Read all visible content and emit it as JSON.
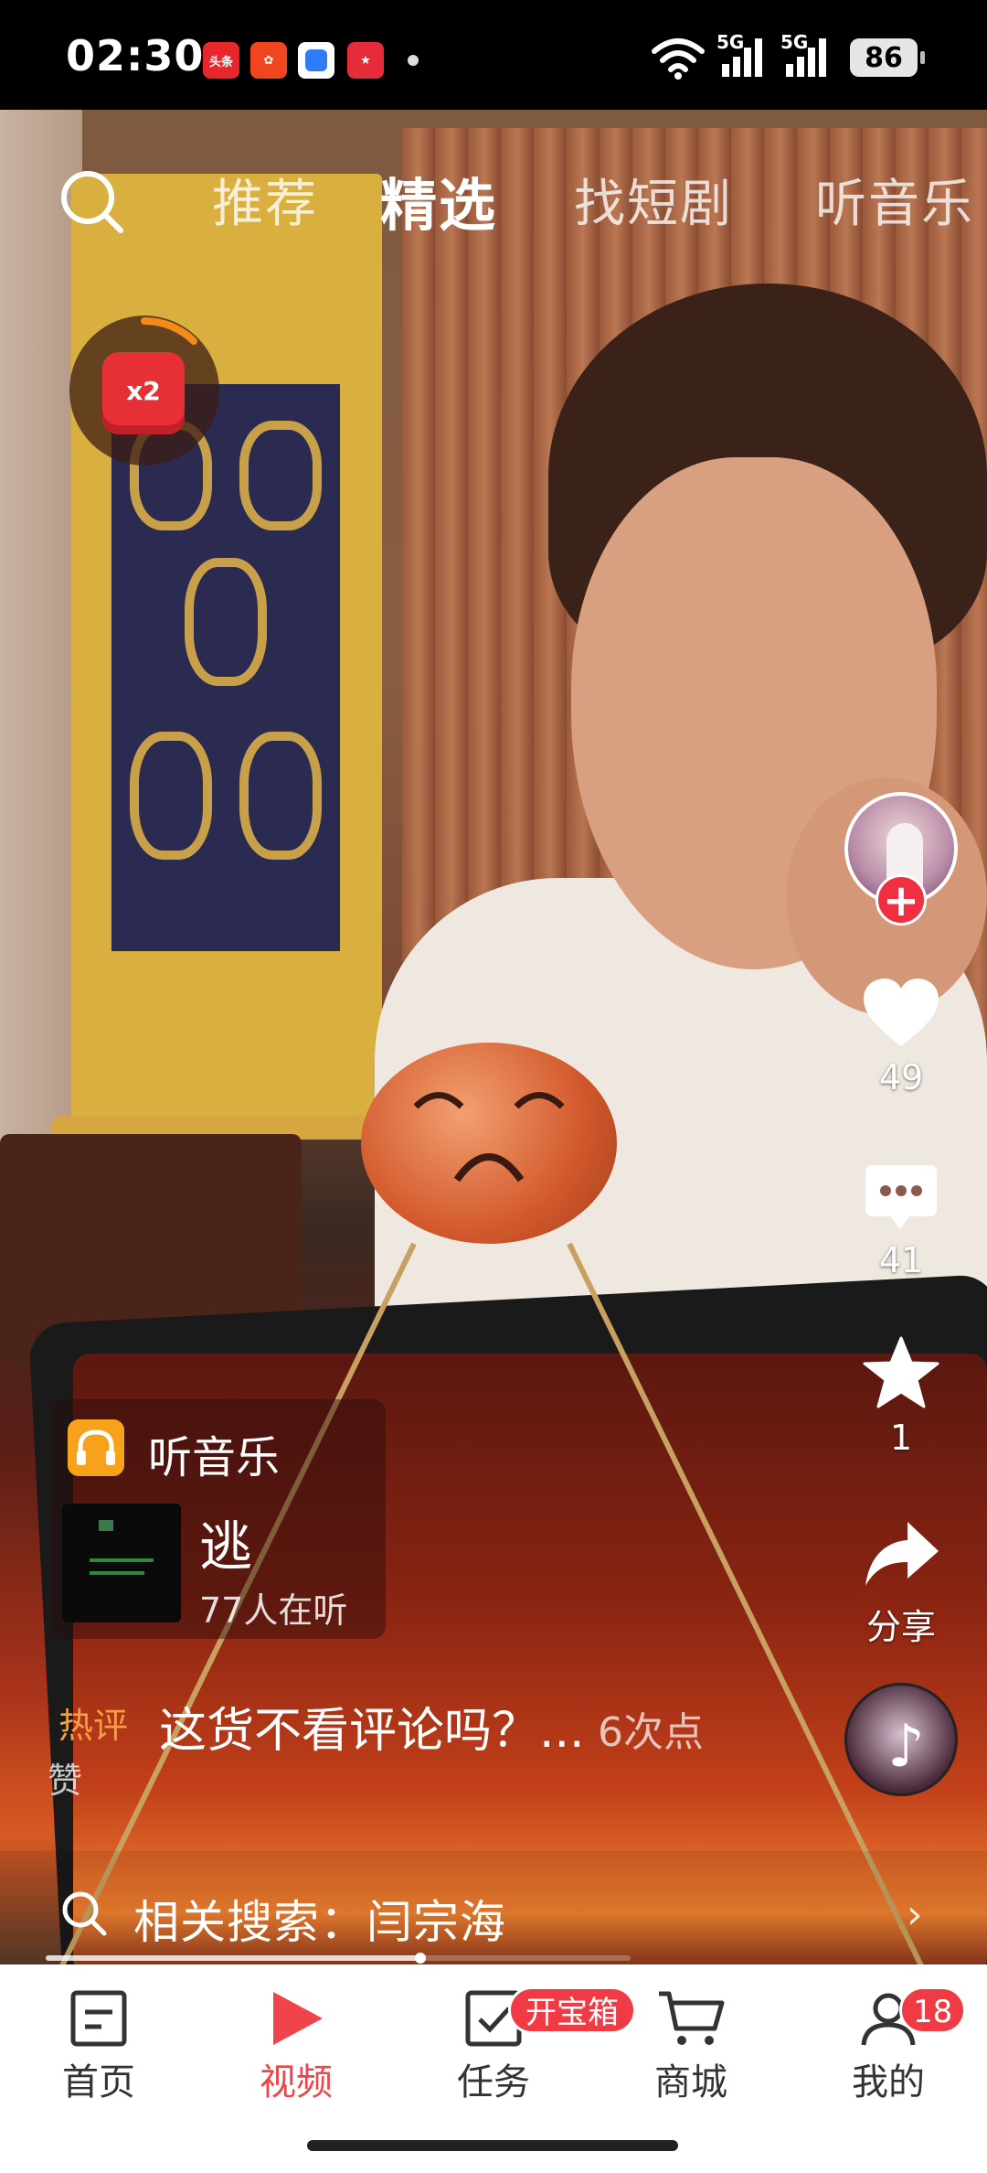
{
  "status_bar": {
    "time": "02:30",
    "notifications": [
      "头条",
      "app-icon",
      "browser-icon",
      "game-icon"
    ],
    "network_1": "5G",
    "network_2": "5G",
    "battery": "86"
  },
  "top_nav": {
    "tabs": [
      {
        "label": "推荐",
        "active": false
      },
      {
        "label": "精选",
        "active": true
      },
      {
        "label": "找短剧",
        "active": false
      },
      {
        "label": "听音乐",
        "active": false
      }
    ]
  },
  "red_packet": {
    "label": "x2"
  },
  "right_rail": {
    "like_count": "49",
    "comment_count": "41",
    "favorite_count": "1",
    "share_label": "分享"
  },
  "music_card": {
    "label": "听音乐",
    "song_title": "逃",
    "listeners": "77人在听"
  },
  "hot_comment": {
    "tag": "热评",
    "text": "这货不看评论吗？...",
    "likes": "6次点",
    "likes_suffix": "赞"
  },
  "related_search": {
    "text": "相关搜索：闫宗海"
  },
  "playback": {
    "progress": 0.64
  },
  "bottom_nav": {
    "items": [
      {
        "label": "首页",
        "active": false
      },
      {
        "label": "视频",
        "active": true
      },
      {
        "label": "任务",
        "active": false
      },
      {
        "label": "商城",
        "active": false
      },
      {
        "label": "我的",
        "active": false
      }
    ],
    "task_badge": "开宝箱",
    "profile_badge": "18"
  },
  "colors": {
    "accent": "#f0444a",
    "badge": "#f03a44",
    "music_badge": "#f7a21b",
    "hot_tag": "#f4a040"
  }
}
